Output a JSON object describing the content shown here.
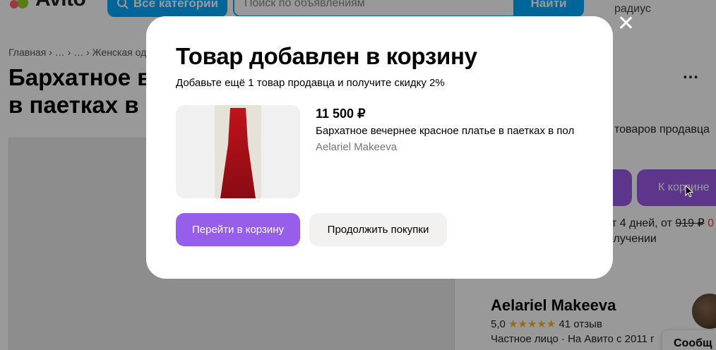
{
  "header": {
    "logo_text": "Avito",
    "categories_label": "Все категории",
    "search_placeholder": "Поиск по объявлениям",
    "search_button_label": "Найти",
    "radius_label": "радиус"
  },
  "breadcrumb": {
    "items": [
      "Главная",
      "…",
      "…",
      "Женская одежда"
    ],
    "separator": "›"
  },
  "listing": {
    "title_line1": "Бархатное вечернее красное платье",
    "title_line2": "в паетках в"
  },
  "sidebar": {
    "seller_items_note": "товаров продавца",
    "cart_button_label": "К корзине",
    "delivery_prefix": "т 4 дней, от",
    "old_price": "919 ₽",
    "new_price": "0",
    "receive_text": "олучении",
    "seller_name": "Aelariel Makeeva",
    "rating_value": "5,0",
    "stars": "★★★★★",
    "reviews": "41 отзыв",
    "seller_type": "Частное лицо · На Авито с 2011 г",
    "message_button_label": "Сообщ"
  },
  "modal": {
    "title": "Товар добавлен в корзину",
    "subtitle": "Добавьте ещё 1 товар продавца и получите скидку 2%",
    "product": {
      "price": "11 500 ₽",
      "name": "Бархатное вечернее красное платье в паетках в пол",
      "seller": "Aelariel Makeeva"
    },
    "primary_button": "Перейти в корзину",
    "secondary_button": "Продолжить покупки"
  },
  "colors": {
    "accent_purple": "#965eeb",
    "avito_blue": "#00aaff",
    "star_color": "#ffb021",
    "discount_red": "#ff3030"
  },
  "icons": [
    "search-icon",
    "close-icon",
    "more-icon",
    "star-icon",
    "cursor-icon"
  ]
}
